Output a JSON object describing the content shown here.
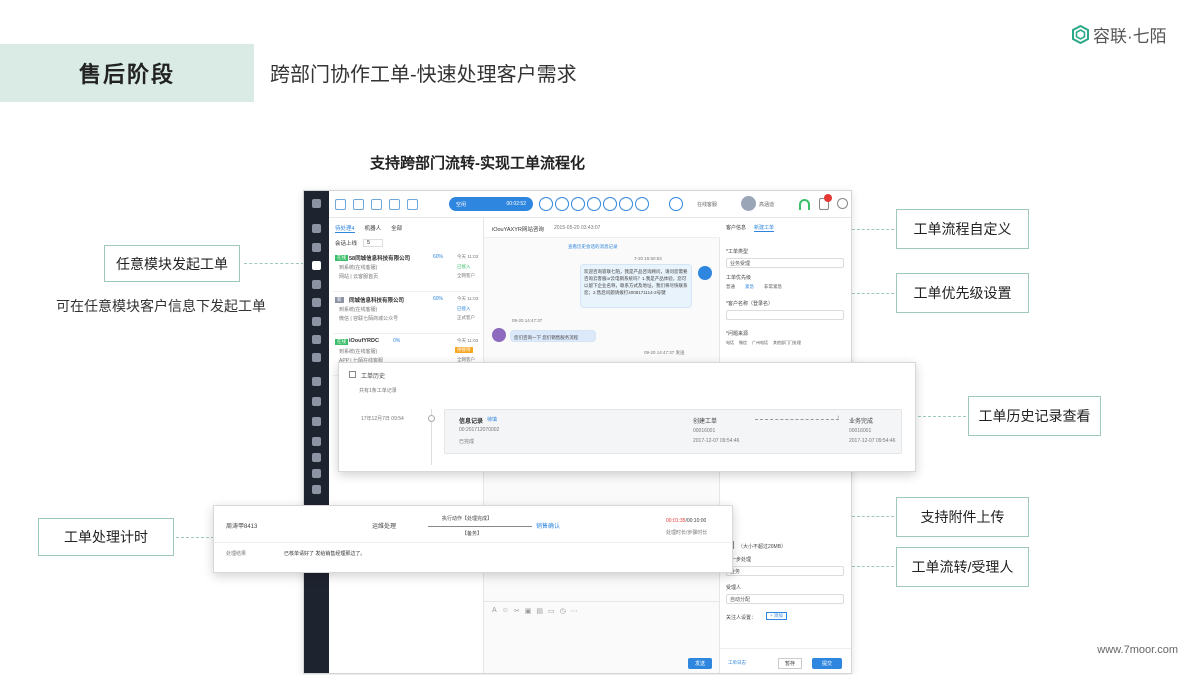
{
  "header": {
    "stage_label": "售后阶段",
    "page_title": "跨部门协作工单-快速处理客户需求",
    "logo_text": "容联·七陌",
    "section_title": "支持跨部门流转-实现工单流程化",
    "footer_url": "www.7moor.com"
  },
  "callouts": {
    "start_ticket": "任意模块发起工单",
    "start_ticket_desc": "可在任意模块客户信息下发起工单",
    "timer": "工单处理计时",
    "custom_flow": "工单流程自定义",
    "priority": "工单优先级设置",
    "history": "工单历史记录查看",
    "attachment": "支持附件上传",
    "transfer": "工单流转/受理人"
  },
  "colors": {
    "accent_green": "#9fc9b8",
    "stage_bg": "#d9ebe4",
    "app_blue": "#2f86de",
    "rail_dark": "#1e2330"
  },
  "app": {
    "toolbar": {
      "state_label": "空闲",
      "state_time": "00:02:52",
      "status_text": "在线客服",
      "agent_name": "高涵迪"
    },
    "list": {
      "tabs": [
        "待处理4",
        "机器人",
        "全部"
      ],
      "sort_label": "会话上线",
      "sort_value": "5",
      "items": [
        {
          "badge": "在线",
          "name": "58同城信息科技有限公司",
          "pct": "60%",
          "time": "今天 11:03",
          "sub": "到系统(在线客服)",
          "channel": "网站 | 云客服首页",
          "status": "已接入",
          "tag": "全网客户"
        },
        {
          "badge": "新",
          "name": "同城信息科技有限公司",
          "pct": "60%",
          "time": "今天 11:03",
          "sub": "到系统(在线客服)",
          "channel": "微信 | 容联七陌商城公众号",
          "status": "已接入",
          "tag": "正式客户"
        },
        {
          "badge": "在线",
          "name": "iOoufYRDC",
          "pct": "0%",
          "time": "今天 11:03",
          "sub": "到系统(在线客服)",
          "channel": "APP | 七陌在线客服",
          "status": "待接待",
          "tag": "全网客户"
        }
      ]
    },
    "conversation": {
      "title": "iOouYAXYR网站咨询",
      "title_time": "2015-05-20 03:43:07",
      "history_link": "查看历史会话的消息记录",
      "msg1_time": "7-20 15:50:53",
      "msg1": "欢迎咨询容联七陌，我是产品咨询顾问，请问您需要咨询云客服or云电销系统吗？1.我是产品体验，您可以留下企业名称，联系方式及地址，我们将尽快联系您；2.售后问题请拨打4008171114-2号键",
      "msg2_time": "09-20 14:47:37",
      "msg2": "您们咨询一下 您们销售服务流程",
      "msg3_time": "09-20 14:47:37 发送"
    },
    "form": {
      "tabs": [
        "客户信息",
        "新建工单"
      ],
      "type_label": "*工单类型",
      "type_value": "业务受理",
      "priority_label": "工单优先级",
      "priority_options": [
        "普通",
        "紧急",
        "非常紧急"
      ],
      "customer_label": "*客户名称（登录名）",
      "source_label": "*问题来源",
      "source_options": [
        "电话",
        "微信",
        "广州电话",
        "其他部门门处理"
      ],
      "attach_note": "（大小不超过20MB）",
      "next_label": "下一步处理",
      "next_value": "业务",
      "assignee_label": "受理人",
      "assignee_value": "自动分配",
      "follower_label": "关注人设置：",
      "follower_btn": "+ 添加",
      "footer_link": "工单日志",
      "save_btn": "暂存",
      "submit_btn": "提交"
    },
    "editor_send": "发送"
  },
  "history_card": {
    "title": "工单历史",
    "subtitle": "共有1条工单记录",
    "date": "17年12月7日 09:54",
    "record_title": "信息记录",
    "record_tag": "待填",
    "record_id": "00:201712070002",
    "record_status": "已完成",
    "step1_name": "创建工单",
    "step1_code": "00016001",
    "step1_time": "2017-12-07 09:54:46",
    "step2_name": "业务完成",
    "step2_code": "00016001",
    "step2_time": "2017-12-07 09:54:46"
  },
  "timer_card": {
    "ticket": "周涛甲8413",
    "step_current": "运维处理",
    "action_label": "执行动作【处理完成】",
    "action_tag": "【备务】",
    "step_next": "销售确认",
    "timer_value": "00:01:35",
    "timer_total": "/00:10:00",
    "timer_note": "处理时长/步骤时长",
    "result_label": "处理结果",
    "result_text": "已核单请好了 发给销售经理那边了。"
  }
}
